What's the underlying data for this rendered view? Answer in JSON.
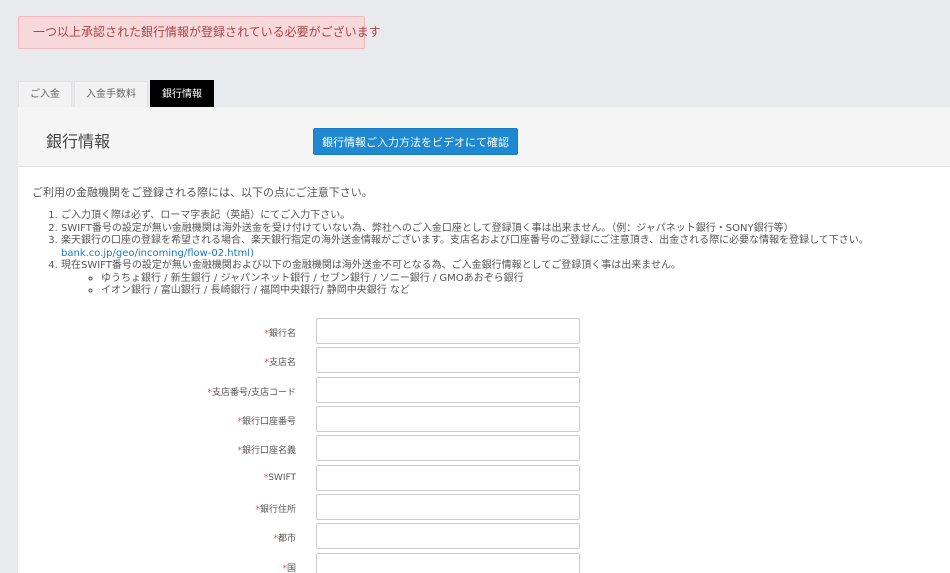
{
  "alert": {
    "message": "一つ以上承認された銀行情報が登録されている必要がございます"
  },
  "tabs": [
    {
      "label": "ご入金"
    },
    {
      "label": "入金手数料"
    },
    {
      "label": "銀行情報"
    }
  ],
  "panel": {
    "title": "銀行情報",
    "video_button": "銀行情報ご入力方法をビデオにて確認"
  },
  "notice": {
    "intro": "ご利用の金融機関をご登録される際には、以下の点にご注意下さい。",
    "items": [
      "ご入力頂く際は必ず、ローマ字表記（英語）にてご入力下さい。",
      "SWIFT番号の設定が無い金融機関は海外送金を受け付けていない為、弊社へのご入金口座として登録頂く事は出来ません。（例：ジャパネット銀行・SONY銀行等）",
      "楽天銀行の口座の登録を希望される場合、楽天銀行指定の海外送金情報がございます。支店名および口座番号のご登録にご注意頂き、出金される際に必要な情報を登録して下さい。",
      "現在SWIFT番号の設定が無い金融機関および以下の金融機関は海外送金不可となる為、ご入金銀行情報としてご登録頂く事は出来ません。"
    ],
    "link_text": "bank.co.jp/geo/incoming/flow-02.html)",
    "sub_items": [
      "ゆうちょ銀行 / 新生銀行 / ジャパンネット銀行 / セブン銀行 / ソニー銀行 / GMOあおぞら銀行",
      "イオン銀行 / 富山銀行 / 長崎銀行 / 福岡中央銀行/ 静岡中央銀行 など"
    ]
  },
  "form": {
    "required_mark": "*",
    "fields": [
      {
        "label": "銀行名",
        "value": ""
      },
      {
        "label": "支店名",
        "value": ""
      },
      {
        "label": "支店番号/支店コード",
        "value": ""
      },
      {
        "label": "銀行口座番号",
        "value": ""
      },
      {
        "label": "銀行口座名義",
        "value": ""
      },
      {
        "label": "SWIFT",
        "value": ""
      },
      {
        "label": "銀行住所",
        "value": ""
      },
      {
        "label": "都市",
        "value": ""
      },
      {
        "label": "国",
        "value": ""
      }
    ]
  },
  "colors": {
    "alert_bg": "#f7d9dc",
    "alert_text": "#a94442",
    "active_tab": "#000000",
    "primary_button": "#1e88d1",
    "link": "#1a78c2",
    "required": "#d9534f"
  }
}
